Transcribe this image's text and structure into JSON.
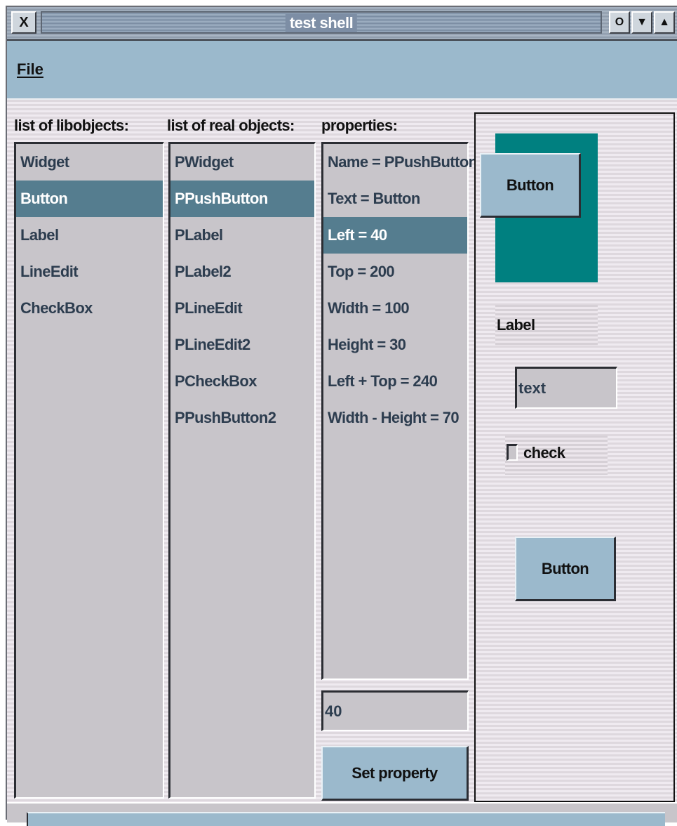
{
  "window": {
    "title": "test shell",
    "close_glyph": "X",
    "min_glyph": "O",
    "menu_glyph": "▼",
    "max_glyph": "▲"
  },
  "menu": {
    "file_label": "File"
  },
  "libobjects": {
    "caption": "list of libobjects:",
    "items": [
      "Widget",
      "Button",
      "Label",
      "LineEdit",
      "CheckBox"
    ],
    "selected": "Button"
  },
  "realobjects": {
    "caption": "list of real objects:",
    "items": [
      "PWidget",
      "PPushButton",
      "PLabel",
      "PLabel2",
      "PLineEdit",
      "PLineEdit2",
      "PCheckBox",
      "PPushButton2"
    ],
    "selected": "PPushButton"
  },
  "properties": {
    "caption": "properties:",
    "items": [
      "Name = PPushButton",
      "Text = Button",
      "Left = 40",
      "Top = 200",
      "Width = 100",
      "Height = 30",
      "Left + Top = 240",
      "Width - Height = 70"
    ],
    "selected": "Left = 40",
    "value_field": "40",
    "set_button": "Set property"
  },
  "preview": {
    "button1_label": "Button",
    "label_text": "Label",
    "lineedit_value": "text",
    "checkbox_label": "check",
    "checkbox_checked": false,
    "button2_label": "Button",
    "teal_color": "#008080"
  },
  "colors": {
    "selection": "#557d8f",
    "button_face": "#9bb9cc",
    "list_background": "#c8c5ca"
  }
}
